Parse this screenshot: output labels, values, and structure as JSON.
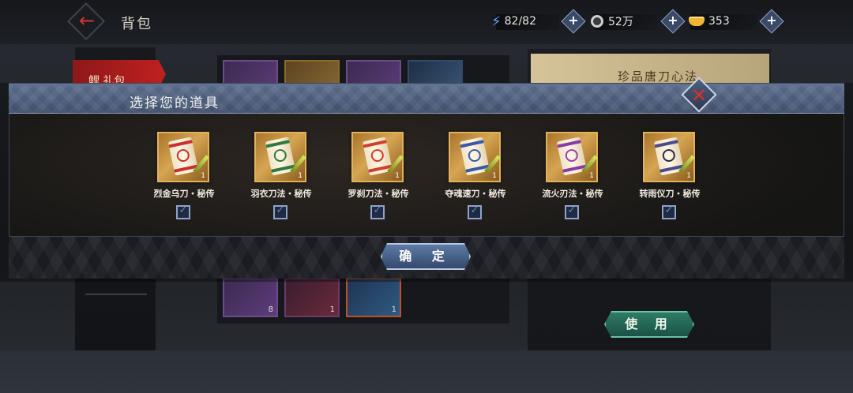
{
  "header": {
    "title": "背包",
    "energy": "82/82",
    "silver": "52万",
    "gold": "353"
  },
  "left_panel": {
    "active_tab": "鲤 礼包"
  },
  "detail": {
    "title": "珍品唐刀心法",
    "use_label": "使 用"
  },
  "background_items": [
    {
      "count": "8"
    },
    {
      "count": "1"
    },
    {
      "count": "1"
    }
  ],
  "modal": {
    "title": "选择您的道具",
    "confirm_label": "确 定",
    "items": [
      {
        "name": "烈金乌刀・秘传",
        "qty": "1",
        "band_color": "#c8302a",
        "mark_color": "#c8302a",
        "checked": false
      },
      {
        "name": "羽衣刀法・秘传",
        "qty": "1",
        "band_color": "#2e7a3c",
        "mark_color": "#2e7a3c",
        "checked": false
      },
      {
        "name": "罗刹刀法・秘传",
        "qty": "1",
        "band_color": "#d0402a",
        "mark_color": "#d03a2a",
        "checked": false
      },
      {
        "name": "夺魂速刀・秘传",
        "qty": "1",
        "band_color": "#3a5aa8",
        "mark_color": "#3a5aa8",
        "checked": false
      },
      {
        "name": "流火刃法・秘传",
        "qty": "1",
        "band_color": "#8a3aa8",
        "mark_color": "#9a40b8",
        "checked": false
      },
      {
        "name": "转雨仪刀・秘传",
        "qty": "1",
        "band_color": "#4a4a8a",
        "mark_color": "#2a2a4a",
        "checked": false
      }
    ]
  },
  "colors": {
    "accent_red": "#d7342c",
    "modal_header": "#4f6080",
    "confirm_button": "#4a6490",
    "use_button": "#2e7b66"
  },
  "icons": {
    "back": "left-arrow-icon",
    "energy": "lightning-icon",
    "silver": "coin-icon",
    "gold": "ingot-icon",
    "add": "plus-icon",
    "close": "close-icon",
    "checkbox": "check-icon"
  }
}
